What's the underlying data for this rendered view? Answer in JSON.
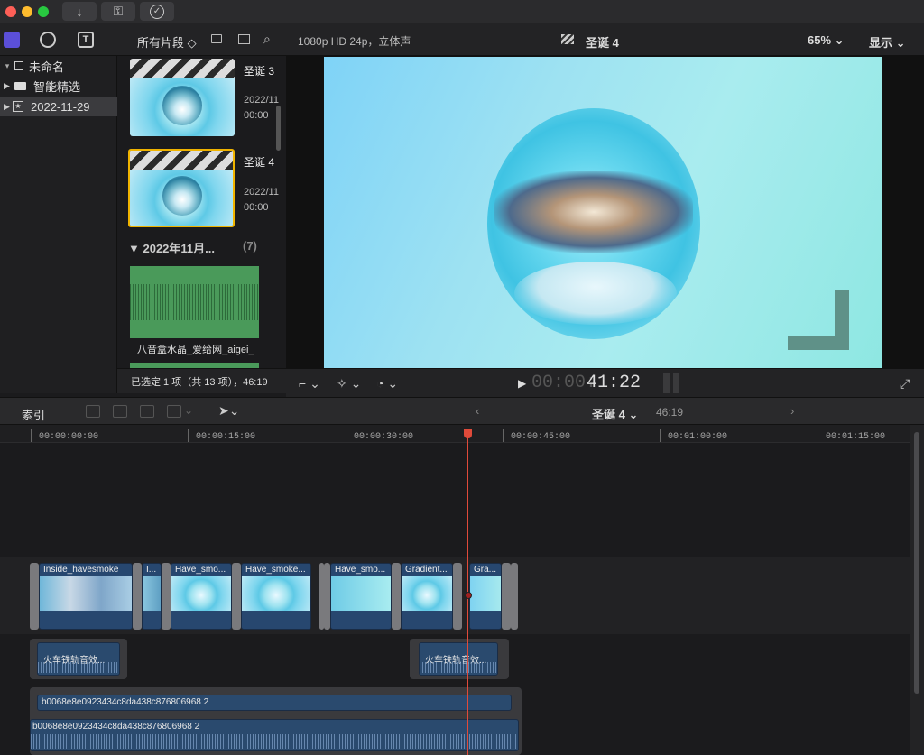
{
  "window": {
    "btn_import": "↓",
    "btn_keys": "⚿",
    "btn_check": "✓"
  },
  "library": {
    "items": [
      {
        "label": "未命名",
        "icon": "library-icon"
      },
      {
        "label": "智能精选",
        "icon": "folder-icon"
      },
      {
        "label": "2022-11-29",
        "icon": "event-star-icon"
      }
    ]
  },
  "browser": {
    "filter": "所有片段 ◇",
    "clips": [
      {
        "title": "圣诞 3",
        "date": "2022/11",
        "dur": "00:00"
      },
      {
        "title": "圣诞 4",
        "date": "2022/11",
        "dur": "00:00"
      }
    ],
    "group_header": "▼ 2022年11月...",
    "group_count": "(7)",
    "audio_clip": "八音盒水晶_爱给网_aigei_",
    "status": "已选定 1 项（共 13 项），46:19"
  },
  "viewer": {
    "format": "1080p HD 24p，立体声",
    "title": "圣诞 4",
    "zoom": "65% ⌄",
    "display": "显示 ⌄",
    "timecode_dim": "00:00:",
    "timecode": "41:22"
  },
  "timeline": {
    "index": "索引",
    "project": "圣诞 4 ⌄",
    "duration": "46:19",
    "ticks": [
      "00:00:00:00",
      "00:00:15:00",
      "00:00:30:00",
      "00:00:45:00",
      "00:01:00:00",
      "00:01:15:00"
    ],
    "clips": [
      "Inside_havesmoke",
      "I...",
      "Have_smo...",
      "Have_smoke...",
      "Have_smo...",
      "Gradient...",
      "Gra..."
    ],
    "audio1": "火车铁轨音效...",
    "audio2": "火车铁轨音效...",
    "music1": "b0068e8e0923434c8da438c876806968 2",
    "music2": "b0068e8e0923434c8da438c876806968 2"
  }
}
